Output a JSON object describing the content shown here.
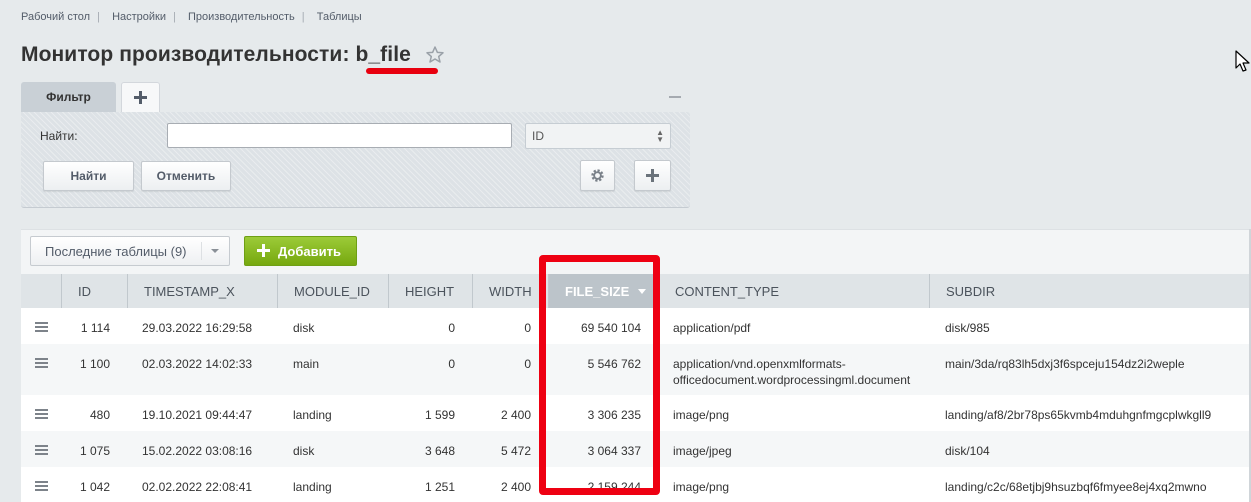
{
  "breadcrumb": [
    "Рабочий стол",
    "Настройки",
    "Производительность",
    "Таблицы"
  ],
  "page": {
    "title": "Монитор производительности: b_file"
  },
  "filter": {
    "tab_label": "Фильтр",
    "find_label": "Найти:",
    "search_value": "",
    "field_select": "ID",
    "find_button": "Найти",
    "cancel_button": "Отменить"
  },
  "toolbar": {
    "recent_tables": "Последние таблицы (9)",
    "add_button": "Добавить"
  },
  "table": {
    "columns": [
      "ID",
      "TIMESTAMP_X",
      "MODULE_ID",
      "HEIGHT",
      "WIDTH",
      "FILE_SIZE",
      "CONTENT_TYPE",
      "SUBDIR"
    ],
    "sorted_column": "FILE_SIZE",
    "rows": [
      {
        "id": "1 114",
        "timestamp": "29.03.2022 16:29:58",
        "module": "disk",
        "height": "0",
        "width": "0",
        "file_size": "69 540 104",
        "content_type": "application/pdf",
        "content_type_2": "",
        "subdir": "disk/985"
      },
      {
        "id": "1 100",
        "timestamp": "02.03.2022 14:02:33",
        "module": "main",
        "height": "0",
        "width": "0",
        "file_size": "5 546 762",
        "content_type": "application/vnd.openxmlformats-",
        "content_type_2": "officedocument.wordprocessingml.document",
        "subdir": "main/3da/rq83lh5dxj3f6spceju154dz2i2weple"
      },
      {
        "id": "480",
        "timestamp": "19.10.2021 09:44:47",
        "module": "landing",
        "height": "1 599",
        "width": "2 400",
        "file_size": "3 306 235",
        "content_type": "image/png",
        "content_type_2": "",
        "subdir": "landing/af8/2br78ps65kvmb4mduhgnfmgcplwkgll9"
      },
      {
        "id": "1 075",
        "timestamp": "15.02.2022 03:08:16",
        "module": "disk",
        "height": "3 648",
        "width": "5 472",
        "file_size": "3 064 337",
        "content_type": "image/jpeg",
        "content_type_2": "",
        "subdir": "disk/104"
      },
      {
        "id": "1 042",
        "timestamp": "02.02.2022 22:08:41",
        "module": "landing",
        "height": "1 251",
        "width": "2 400",
        "file_size": "2 159 244",
        "content_type": "image/png",
        "content_type_2": "",
        "subdir": "landing/c2c/68etjbj9hsuzbqf6fmyee8ej4xq2mwno"
      }
    ]
  },
  "icons": {
    "star": "star-icon",
    "add_tab": "plus-icon",
    "collapse": "minus-icon",
    "settings": "gear-icon",
    "add_field": "plus-icon",
    "row_menu": "hamburger-icon",
    "cursor": "mouse-cursor-icon"
  },
  "colors": {
    "highlight": "#ee0012",
    "add_button": "#8bbd27",
    "sorted_header": "#bcc4ca"
  }
}
